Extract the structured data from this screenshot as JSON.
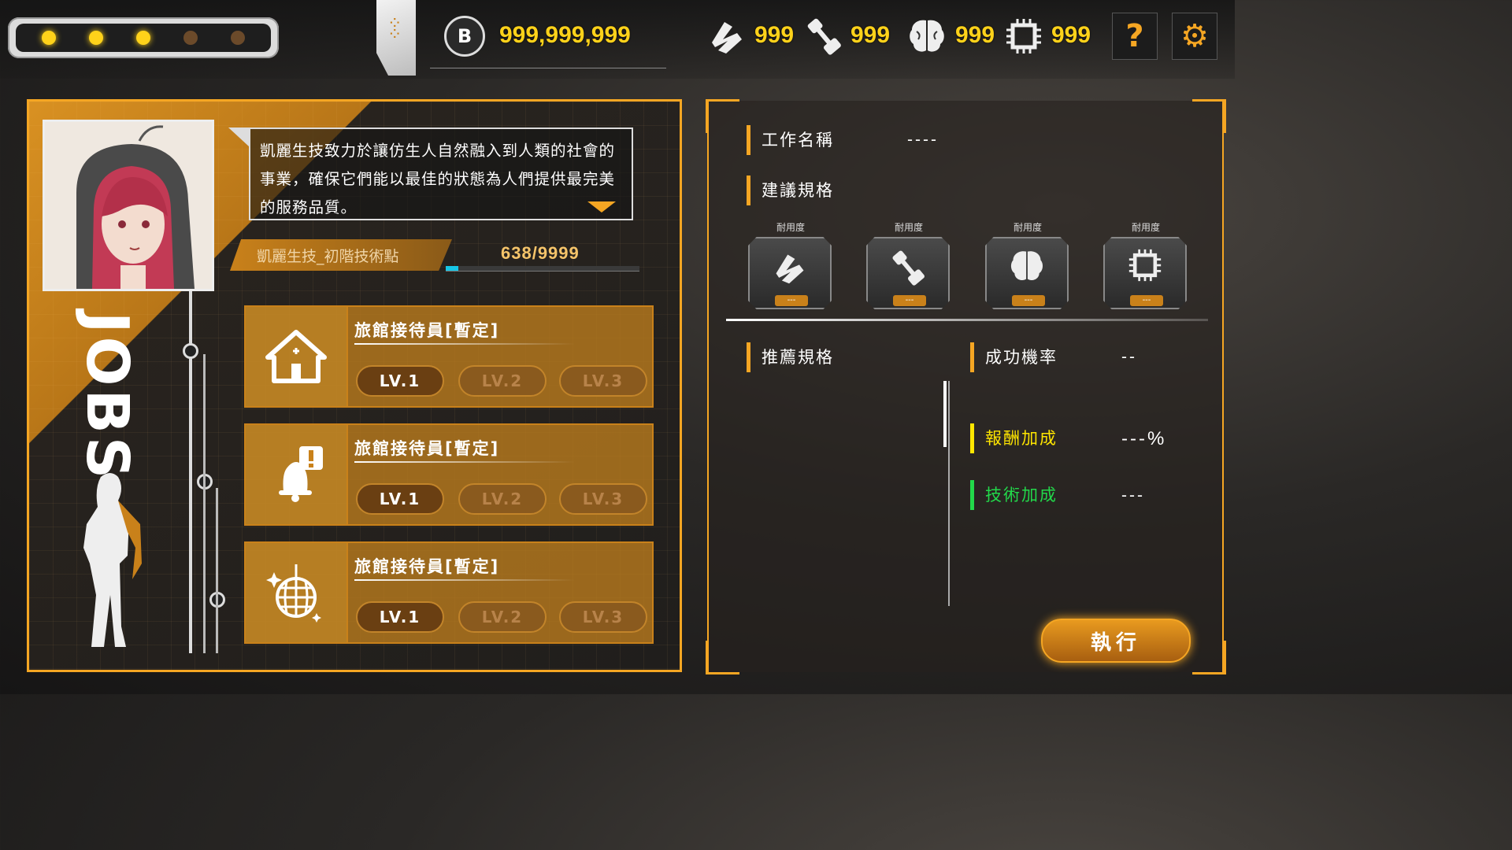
{
  "topbar": {
    "progress_dots": [
      true,
      true,
      true,
      false,
      false
    ],
    "currency": {
      "value": "999,999,999"
    },
    "resources": [
      {
        "icon": "wrench-icon",
        "value": "999"
      },
      {
        "icon": "dumbbell-icon",
        "value": "999"
      },
      {
        "icon": "brain-icon",
        "value": "999"
      },
      {
        "icon": "chip-icon",
        "value": "999"
      }
    ],
    "help_label": "?"
  },
  "jobs": {
    "side_title": "JOBS",
    "description": "凱麗生技致力於讓仿生人自然融入到人類的社會的事業，確保它們能以最佳的狀態為人們提供最完美的服務品質。",
    "tech_label": "凱麗生技_初階技術點",
    "tech_progress": "638/9999",
    "tech_fraction": 0.064,
    "list": [
      {
        "icon": "house-icon",
        "title": "旅館接待員[暫定]",
        "levels": [
          "LV.1",
          "LV.2",
          "LV.3"
        ],
        "unlocked": 1
      },
      {
        "icon": "bell-alert-icon",
        "title": "旅館接待員[暫定]",
        "levels": [
          "LV.1",
          "LV.2",
          "LV.3"
        ],
        "unlocked": 1
      },
      {
        "icon": "disco-ball-icon",
        "title": "旅館接待員[暫定]",
        "levels": [
          "LV.1",
          "LV.2",
          "LV.3"
        ],
        "unlocked": 1
      }
    ]
  },
  "detail": {
    "job_name_label": "工作名稱",
    "job_name_value": "----",
    "suggested_label": "建議規格",
    "specs": [
      {
        "icon": "wrench-icon",
        "name": "耐用度",
        "value": "---"
      },
      {
        "icon": "dumbbell-icon",
        "name": "耐用度",
        "value": "---"
      },
      {
        "icon": "brain-icon",
        "name": "耐用度",
        "value": "---"
      },
      {
        "icon": "chip-icon",
        "name": "耐用度",
        "value": "---"
      }
    ],
    "recommended_label": "推薦規格",
    "success_label": "成功機率",
    "success_value": "--",
    "reward_label": "報酬加成",
    "reward_value": "---%",
    "tech_bonus_label": "技術加成",
    "tech_bonus_value": "---",
    "execute_label": "執行"
  },
  "colors": {
    "accent": "#f5a623",
    "reward": "#ffe600",
    "tech": "#22d84a",
    "progress": "#17c6e6"
  }
}
